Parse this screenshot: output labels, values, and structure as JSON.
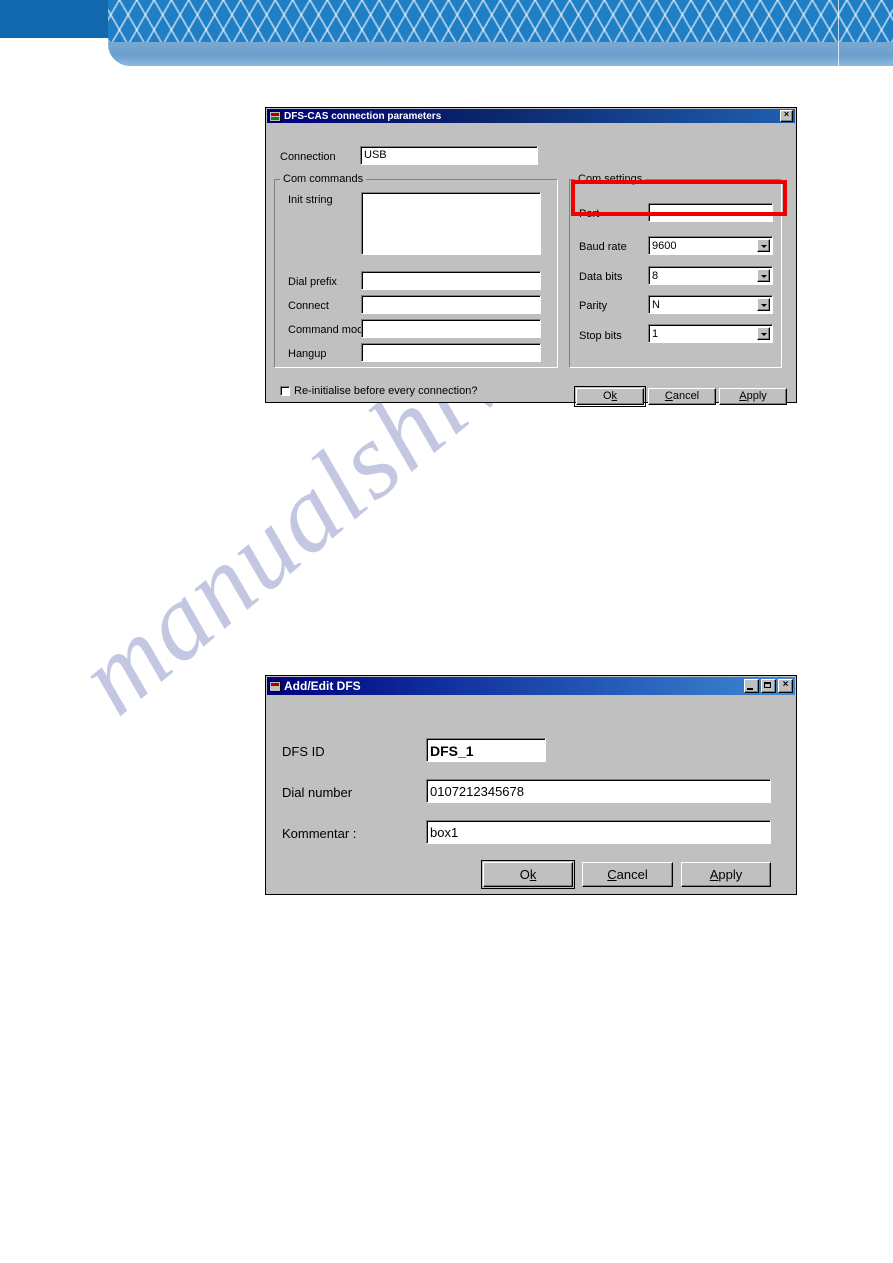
{
  "banner": {
    "accent_dark": "#1268ae",
    "accent_mesh": "#1f7ec4",
    "accent_strip": "#6a9fce"
  },
  "watermark": {
    "text": "manualshive.com",
    "color": "#b9bede"
  },
  "highlight": {
    "color": "#ee0000"
  },
  "dialog_connection": {
    "title": "DFS-CAS connection parameters",
    "icon": "connection-plug-icon",
    "close_label": "×",
    "connection": {
      "label": "Connection",
      "value": "USB"
    },
    "com_commands": {
      "legend": "Com commands",
      "fields": [
        {
          "label": "Init string",
          "value": ""
        },
        {
          "label": "Dial prefix",
          "value": ""
        },
        {
          "label": "Connect",
          "value": ""
        },
        {
          "label": "Command mode",
          "value": ""
        },
        {
          "label": "Hangup",
          "value": ""
        }
      ]
    },
    "com_settings": {
      "legend": "Com settings",
      "fields": [
        {
          "label": "Port",
          "value": ""
        },
        {
          "label": "Baud rate",
          "value": "9600"
        },
        {
          "label": "Data bits",
          "value": "8"
        },
        {
          "label": "Parity",
          "value": "N"
        },
        {
          "label": "Stop bits",
          "value": "1"
        }
      ]
    },
    "reinit_checkbox": {
      "label": "Re-initialise before every connection?",
      "checked": false
    },
    "buttons": [
      {
        "label": "Ok",
        "accel": "k"
      },
      {
        "label": "Cancel",
        "accel": "C"
      },
      {
        "label": "Apply",
        "accel": "A"
      }
    ]
  },
  "dialog_dfs": {
    "title": "Add/Edit DFS",
    "icon": "window-document-icon",
    "minimize_label": "",
    "maximize_label": "",
    "close_label": "×",
    "fields": [
      {
        "label": "DFS ID",
        "value": "DFS_1"
      },
      {
        "label": "Dial number",
        "value": "0107212345678"
      },
      {
        "label": "Kommentar    :",
        "value": "box1"
      }
    ],
    "buttons": [
      {
        "label": "Ok",
        "accel": "k"
      },
      {
        "label": "Cancel",
        "accel": "C"
      },
      {
        "label": "Apply",
        "accel": "A"
      }
    ]
  }
}
